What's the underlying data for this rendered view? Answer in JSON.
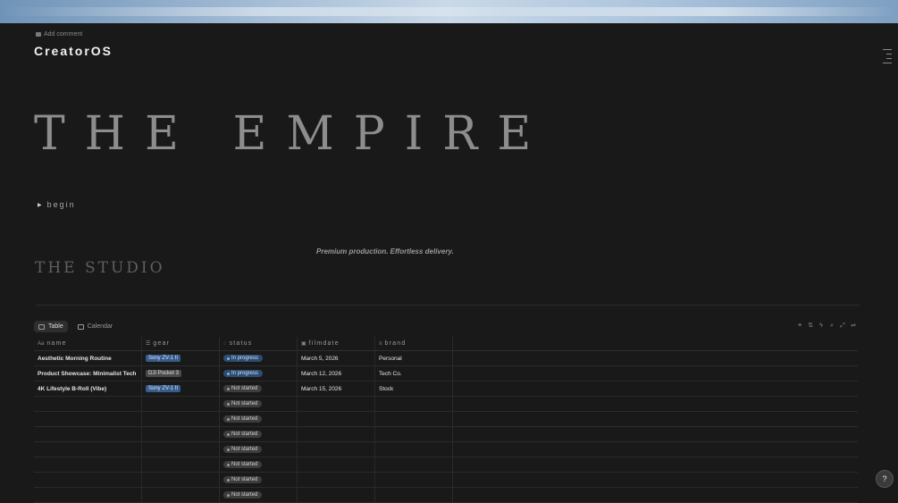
{
  "page": {
    "add_comment": "Add comment",
    "title": "CreatorOS",
    "hero": "THE EMPIRE",
    "toggle_label": "begin",
    "tagline": "Premium production. Effortless delivery.",
    "studio": "THE STUDIO"
  },
  "views": [
    {
      "label": "Table",
      "icon": "table-icon",
      "active": true
    },
    {
      "label": "Calendar",
      "icon": "calendar-icon",
      "active": false
    }
  ],
  "toolbar_icons": [
    "filter-icon",
    "sort-icon",
    "lightning-icon",
    "search-icon",
    "expand-icon",
    "settings-icon"
  ],
  "table": {
    "columns": [
      {
        "label": "name",
        "icon": "Aa"
      },
      {
        "label": "gear",
        "icon": "☰"
      },
      {
        "label": "status",
        "icon": "◌"
      },
      {
        "label": "filmdate",
        "icon": "▣"
      },
      {
        "label": "brand",
        "icon": "≡"
      }
    ],
    "rows": [
      {
        "name": "Aesthetic Morning Routine",
        "gear": "Sony ZV-1 II",
        "gear_color": "blue",
        "status": "In progress",
        "filmdate": "March 5, 2026",
        "brand": "Personal"
      },
      {
        "name": "Product Showcase: Minimalist Tech",
        "gear": "DJI Pocket 3",
        "gear_color": "gray",
        "status": "In progress",
        "filmdate": "March 12, 2026",
        "brand": "Tech Co."
      },
      {
        "name": "4K Lifestyle B-Roll (Vibe)",
        "gear": "Sony ZV-1 II",
        "gear_color": "blue",
        "status": "Not started",
        "filmdate": "March 15, 2026",
        "brand": "Stock"
      },
      {
        "name": "",
        "gear": "",
        "status": "Not started",
        "filmdate": "",
        "brand": ""
      },
      {
        "name": "",
        "gear": "",
        "status": "Not started",
        "filmdate": "",
        "brand": ""
      },
      {
        "name": "",
        "gear": "",
        "status": "Not started",
        "filmdate": "",
        "brand": ""
      },
      {
        "name": "",
        "gear": "",
        "status": "Not started",
        "filmdate": "",
        "brand": ""
      },
      {
        "name": "",
        "gear": "",
        "status": "Not started",
        "filmdate": "",
        "brand": ""
      },
      {
        "name": "",
        "gear": "",
        "status": "Not started",
        "filmdate": "",
        "brand": ""
      },
      {
        "name": "",
        "gear": "",
        "status": "Not started",
        "filmdate": "",
        "brand": ""
      }
    ]
  },
  "help_label": "?",
  "colors": {
    "background": "#191919",
    "in_progress": "#2c4d72",
    "not_started": "#3d3d3d",
    "gear_blue": "#365c8c"
  }
}
